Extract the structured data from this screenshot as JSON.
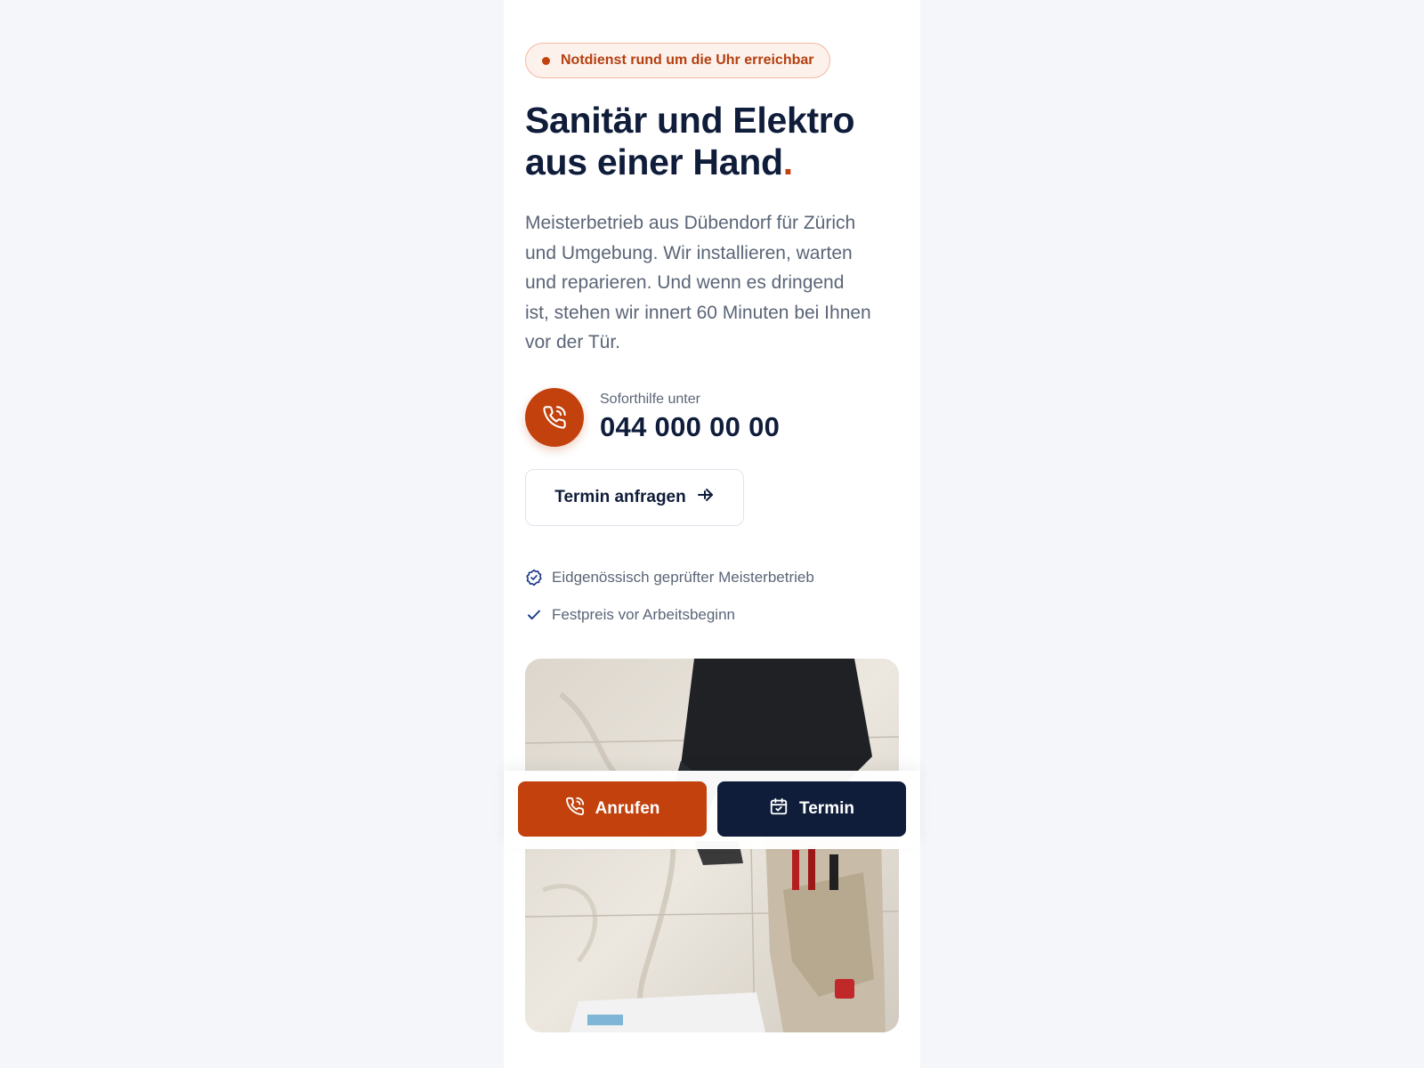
{
  "badge": {
    "text": "Notdienst rund um die Uhr erreichbar"
  },
  "hero": {
    "headline_line1": "Sanitär und Elektro",
    "headline_line2": "aus einer Hand",
    "headline_dot": ".",
    "lead": "Meisterbetrieb aus Dübendorf für Zürich und Umgebung. Wir installieren, warten und reparieren. Und wenn es dringend ist, stehen wir innert 60 Minuten bei Ihnen vor der Tür."
  },
  "hotline": {
    "label": "Soforthilfe unter",
    "number": "044 000 00 00",
    "icon": "phone-icon"
  },
  "cta": {
    "termin_label": "Termin anfragen",
    "icon": "arrow-right-icon"
  },
  "features": [
    {
      "text": "Eidgenössisch geprüfter Meisterbetrieb",
      "icon": "badge-check-icon"
    },
    {
      "text": "Festpreis vor Arbeitsbeginn",
      "icon": "check-icon"
    }
  ],
  "sticky": {
    "call_label": "Anrufen",
    "call_icon": "phone-icon",
    "termin_label": "Termin",
    "termin_icon": "calendar-check-icon"
  },
  "colors": {
    "accent": "#c2410c",
    "navy": "#0f1d3a",
    "muted": "#5b6577",
    "badge_bg": "#fdf1ec"
  }
}
